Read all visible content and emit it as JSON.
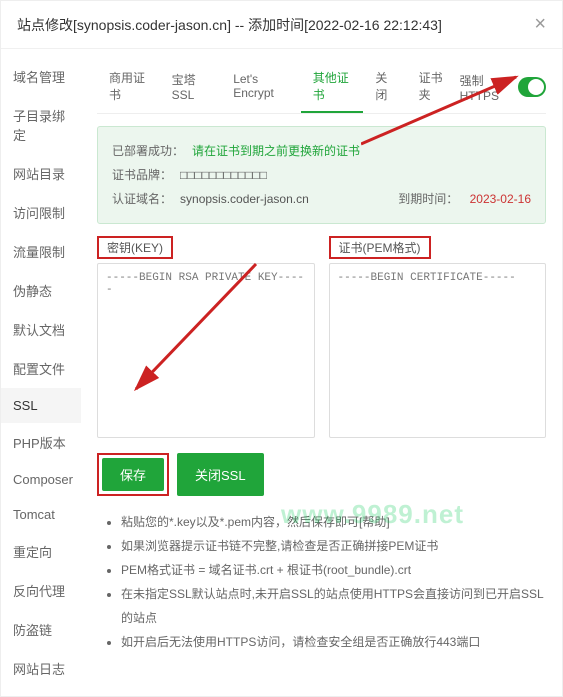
{
  "header": {
    "title": "站点修改[synopsis.coder-jason.cn] -- 添加时间[2022-02-16 22:12:43]"
  },
  "sidebar": {
    "items": [
      {
        "label": "域名管理"
      },
      {
        "label": "子目录绑定"
      },
      {
        "label": "网站目录"
      },
      {
        "label": "访问限制"
      },
      {
        "label": "流量限制"
      },
      {
        "label": "伪静态"
      },
      {
        "label": "默认文档"
      },
      {
        "label": "配置文件"
      },
      {
        "label": "SSL"
      },
      {
        "label": "PHP版本"
      },
      {
        "label": "Composer"
      },
      {
        "label": "Tomcat"
      },
      {
        "label": "重定向"
      },
      {
        "label": "反向代理"
      },
      {
        "label": "防盗链"
      },
      {
        "label": "网站日志"
      }
    ],
    "active_index": 8
  },
  "tabs": {
    "items": [
      {
        "label": "商用证书"
      },
      {
        "label": "宝塔SSL"
      },
      {
        "label": "Let's Encrypt"
      },
      {
        "label": "其他证书"
      },
      {
        "label": "关闭"
      },
      {
        "label": "证书夹"
      }
    ],
    "active_index": 3,
    "force_https_label": "强制HTTPS"
  },
  "info": {
    "deployed_label": "已部署成功：",
    "deployed_hint": "请在证书到期之前更换新的证书",
    "brand_label": "证书品牌：",
    "brand_value": "□□□□□□□□□□□□",
    "domain_label": "认证域名：",
    "domain_value": "synopsis.coder-jason.cn",
    "expire_label": "到期时间：",
    "expire_value": "2023-02-16"
  },
  "key_cert": {
    "key_label": "密钥(KEY)",
    "key_value": "-----BEGIN RSA PRIVATE KEY-----",
    "cert_label": "证书(PEM格式)",
    "cert_value": "-----BEGIN CERTIFICATE-----"
  },
  "buttons": {
    "save": "保存",
    "close_ssl": "关闭SSL"
  },
  "tips": {
    "items": [
      "粘贴您的*.key以及*.pem内容，然后保存即可[帮助]",
      "如果浏览器提示证书链不完整,请检查是否正确拼接PEM证书",
      "PEM格式证书 = 域名证书.crt + 根证书(root_bundle).crt",
      "在未指定SSL默认站点时,未开启SSL的站点使用HTTPS会直接访问到已开启SSL的站点",
      "如开启后无法使用HTTPS访问，请检查安全组是否正确放行443端口"
    ]
  },
  "watermark": "www.9989.net"
}
